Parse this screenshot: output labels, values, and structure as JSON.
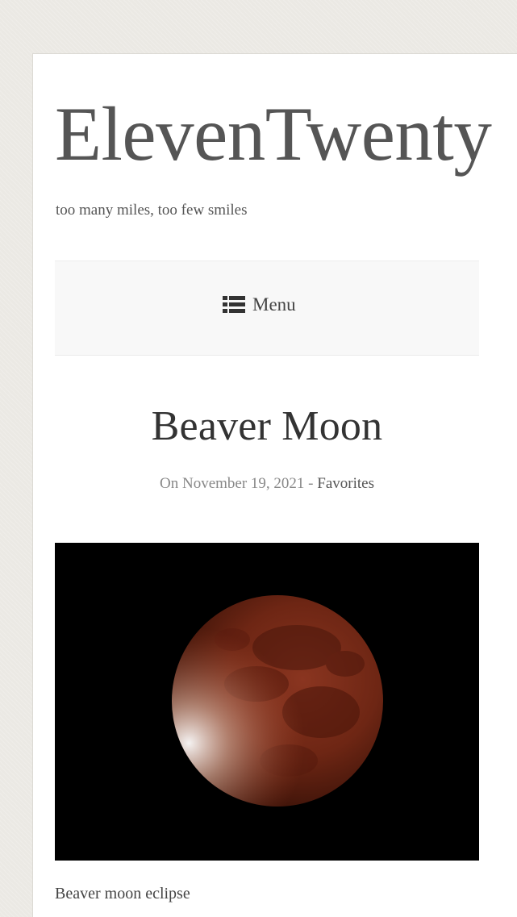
{
  "site": {
    "title": "ElevenTwenty",
    "tagline": "too many miles, too few smiles"
  },
  "nav": {
    "menu_label": "Menu",
    "menu_icon": "list-icon"
  },
  "post": {
    "title": "Beaver Moon",
    "meta_prefix": "On November 19, 2021 - ",
    "category": "Favorites",
    "image_caption": "Beaver moon eclipse"
  },
  "colors": {
    "background": "#ebe9e4",
    "page": "#ffffff",
    "nav_bg": "#f8f8f8",
    "moon": "#7a2a18"
  }
}
